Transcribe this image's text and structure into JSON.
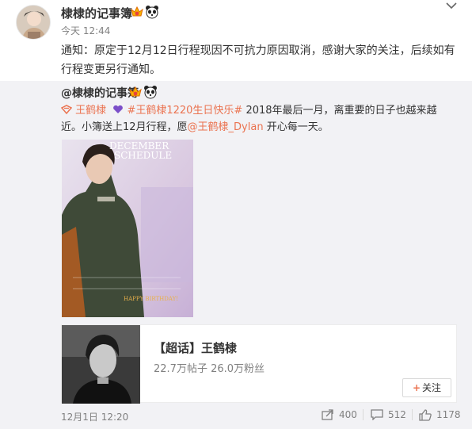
{
  "post": {
    "author": "棣棣的记事簿",
    "time": "今天 12:44",
    "text": "通知：原定于12月12日行程现因不可抗力原因取消，感谢大家的关注，后续如有行程变更另行通知。",
    "icons": [
      "vip-badge-icon",
      "panda-icon",
      "chevron-down-icon"
    ]
  },
  "repost": {
    "author": "@棣棣的记事簿",
    "super_topic_link": "王鹤棣",
    "hashtag_link": "#王鹤棣1220生日快乐#",
    "text_main": " 2018年最后一月，离重要的日子也越来越近。小簿送上12月行程，愿",
    "mention_link": "@王鹤棣_Dylan",
    "text_end": " 开心每一天。",
    "poster": {
      "line1": "DECEMBER",
      "line2": "SCHEDULE",
      "footer": "HAPPY BIRTHDAY!"
    },
    "card": {
      "title_bracket": "【超话】",
      "title_name": "王鹤棣",
      "stats": "22.7万帖子 26.0万粉丝",
      "follow_label": "关注"
    },
    "time": "12月1日 12:20",
    "actions": {
      "repost_count": "400",
      "comment_count": "512",
      "like_count": "1178"
    }
  },
  "colors": {
    "accent": "#eb7350",
    "repost_bg": "#f2f2f5",
    "meta_gray": "#808080"
  }
}
